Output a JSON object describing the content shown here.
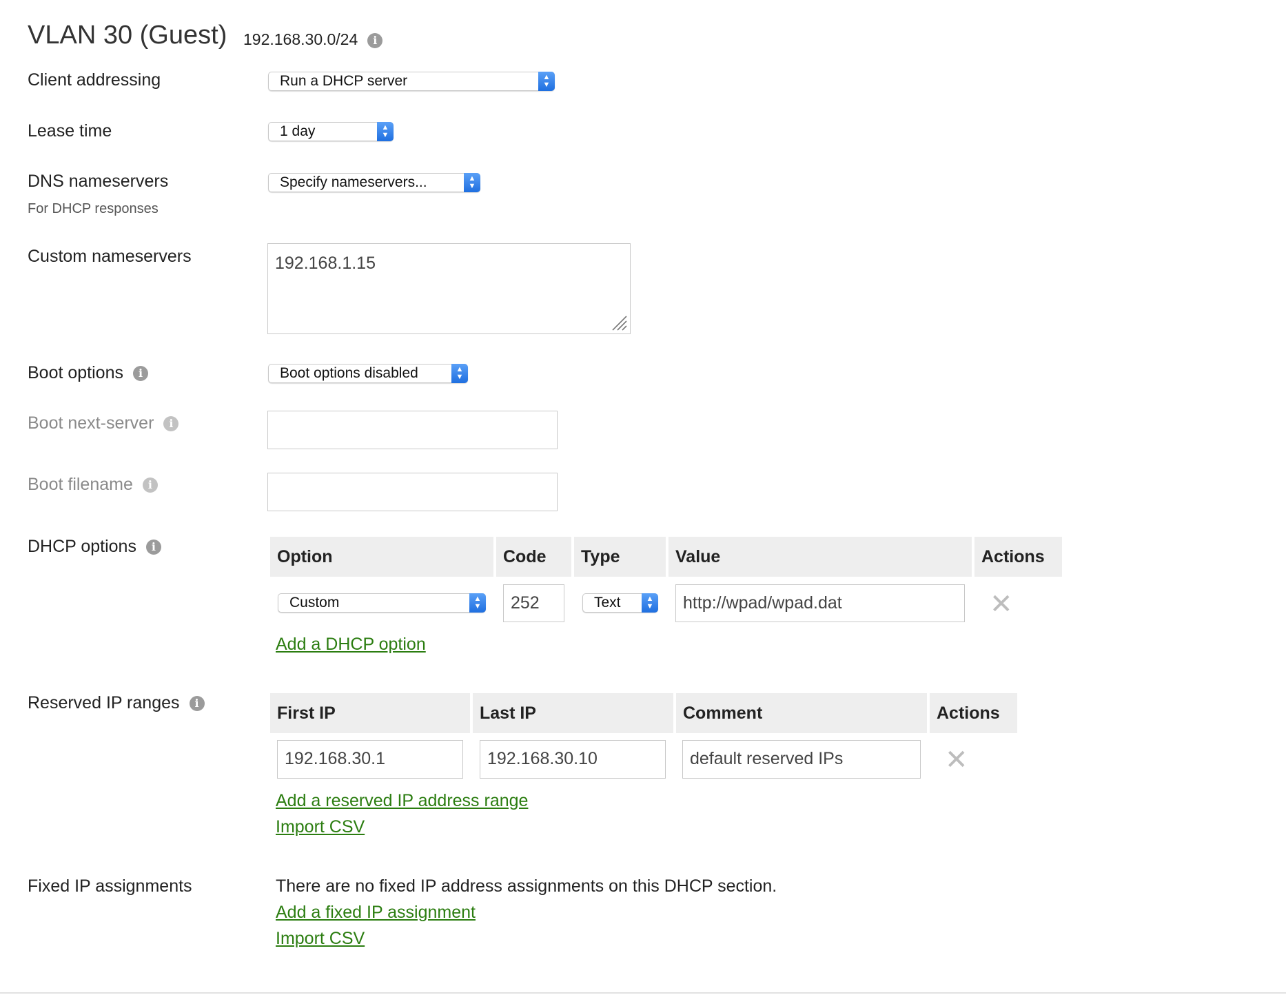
{
  "header": {
    "title": "VLAN 30 (Guest)",
    "subnet": "192.168.30.0/24"
  },
  "icons": {
    "info": "info-icon",
    "remove": "close-icon",
    "select_arrow": "chevron-updown-icon",
    "resize": "resize-grip-icon"
  },
  "colors": {
    "link": "#2b7d10",
    "select_arrow": "#2f7ff0",
    "table_header": "#eeeeee",
    "disabled_label": "#8a8a8a"
  },
  "client_addressing": {
    "label": "Client addressing",
    "value": "Run a DHCP server"
  },
  "lease_time": {
    "label": "Lease time",
    "value": "1 day"
  },
  "dns": {
    "label": "DNS nameservers",
    "sublabel": "For DHCP responses",
    "value": "Specify nameservers..."
  },
  "custom_ns": {
    "label": "Custom nameservers",
    "value": "192.168.1.15"
  },
  "boot_options": {
    "label": "Boot options",
    "value": "Boot options disabled"
  },
  "boot_next_server": {
    "label": "Boot next-server",
    "value": ""
  },
  "boot_filename": {
    "label": "Boot filename",
    "value": ""
  },
  "dhcp_options": {
    "label": "DHCP options",
    "headers": {
      "option": "Option",
      "code": "Code",
      "type": "Type",
      "value": "Value",
      "actions": "Actions"
    },
    "rows": [
      {
        "option": "Custom",
        "code": "252",
        "type": "Text",
        "value": "http://wpad/wpad.dat"
      }
    ],
    "add_link": "Add a DHCP option"
  },
  "reserved": {
    "label": "Reserved IP ranges",
    "headers": {
      "first": "First IP",
      "last": "Last IP",
      "comment": "Comment",
      "actions": "Actions"
    },
    "rows": [
      {
        "first": "192.168.30.1",
        "last": "192.168.30.10",
        "comment": "default reserved IPs"
      }
    ],
    "add_link": "Add a reserved IP address range",
    "import_link": "Import CSV"
  },
  "fixed": {
    "label": "Fixed IP assignments",
    "empty_text": "There are no fixed IP address assignments on this DHCP section.",
    "add_link": "Add a fixed IP assignment",
    "import_link": "Import CSV"
  }
}
